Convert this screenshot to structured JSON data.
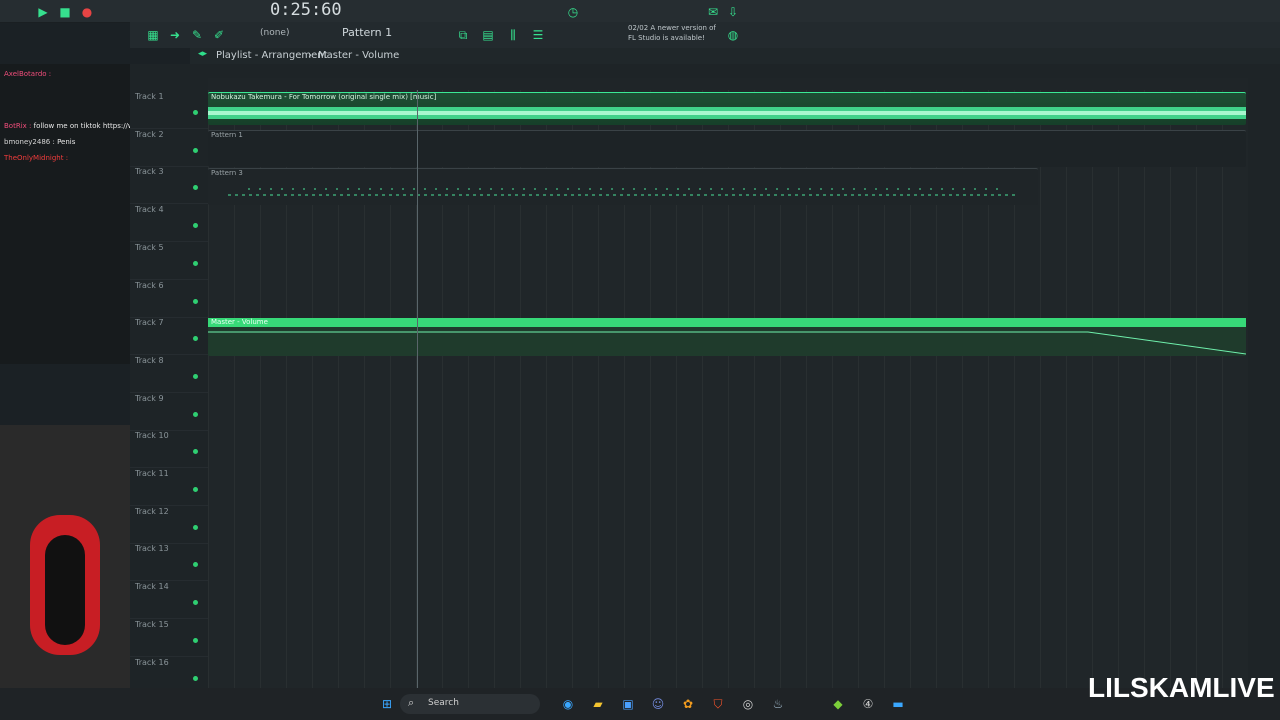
{
  "transport": {
    "time": "0:25:60",
    "pattern": "Pattern 1",
    "preset": "(none)"
  },
  "notice": {
    "line1": "02/02 A newer version of",
    "line2": "FL Studio is available!"
  },
  "breadcrumb": {
    "title": "Playlist - Arrangement",
    "target": "Master - Volume"
  },
  "chat": {
    "lines": [
      {
        "user": "AxelBotardo :",
        "text": ""
      },
      {
        "user": "BotRix :",
        "text": "follow me on tiktok https://www.tiktok.com/@lilskamlive"
      },
      {
        "user": "bmoney2486 :",
        "text": "Penis"
      },
      {
        "user": "TheOnlyMidnight :",
        "text": ""
      }
    ]
  },
  "tracks": [
    {
      "label": "Track 1"
    },
    {
      "label": "Track 2"
    },
    {
      "label": "Track 3"
    },
    {
      "label": "Track 4"
    },
    {
      "label": "Track 5"
    },
    {
      "label": "Track 6"
    },
    {
      "label": "Track 7"
    },
    {
      "label": "Track 8"
    },
    {
      "label": "Track 9"
    },
    {
      "label": "Track 10"
    },
    {
      "label": "Track 11"
    },
    {
      "label": "Track 12"
    },
    {
      "label": "Track 13"
    },
    {
      "label": "Track 14"
    },
    {
      "label": "Track 15"
    },
    {
      "label": "Track 16"
    }
  ],
  "clips": {
    "audio_label": "Nobukazu Takemura - For Tomorrow (original single mix) [music]",
    "pattern1": "Pattern 1",
    "pattern3": "Pattern 3",
    "automation": "Master - Volume"
  },
  "taskbar": {
    "search_placeholder": "Search"
  },
  "watermark": "LILSKAMLIVE",
  "colors": {
    "accent": "#2fe08c",
    "automation": "#37d978",
    "bg": "#1e2427"
  }
}
